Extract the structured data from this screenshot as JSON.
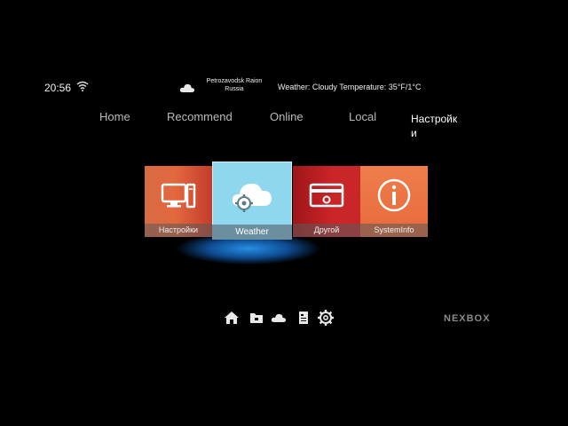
{
  "status_bar": {
    "time": "20:56",
    "location_line1": "Petrozavodsk Raion",
    "location_line2": "Russia",
    "weather_label": "Weather: Cloudy  Temperature: 35°F/1°C"
  },
  "nav": {
    "tabs": [
      "Home",
      "Recommend",
      "Online",
      "Local",
      "Настройк\nи"
    ],
    "active_index": 4
  },
  "tiles": [
    {
      "label": "Настройки",
      "icon": "monitor-pc-icon"
    },
    {
      "label": "Weather",
      "icon": "cloud-gear-icon",
      "selected": true
    },
    {
      "label": "Другой",
      "icon": "card-gear-icon"
    },
    {
      "label": "SystemInfo",
      "icon": "info-icon"
    }
  ],
  "dock": [
    "home-icon",
    "folder-icon",
    "cloud-icon",
    "file-icon",
    "gear-icon"
  ],
  "brand": "NEXBOX",
  "colors": {
    "accent": "#8fd6ef",
    "tile_orange": "#e3683e",
    "tile_red": "#c8272a",
    "glow": "#2a96f0"
  }
}
